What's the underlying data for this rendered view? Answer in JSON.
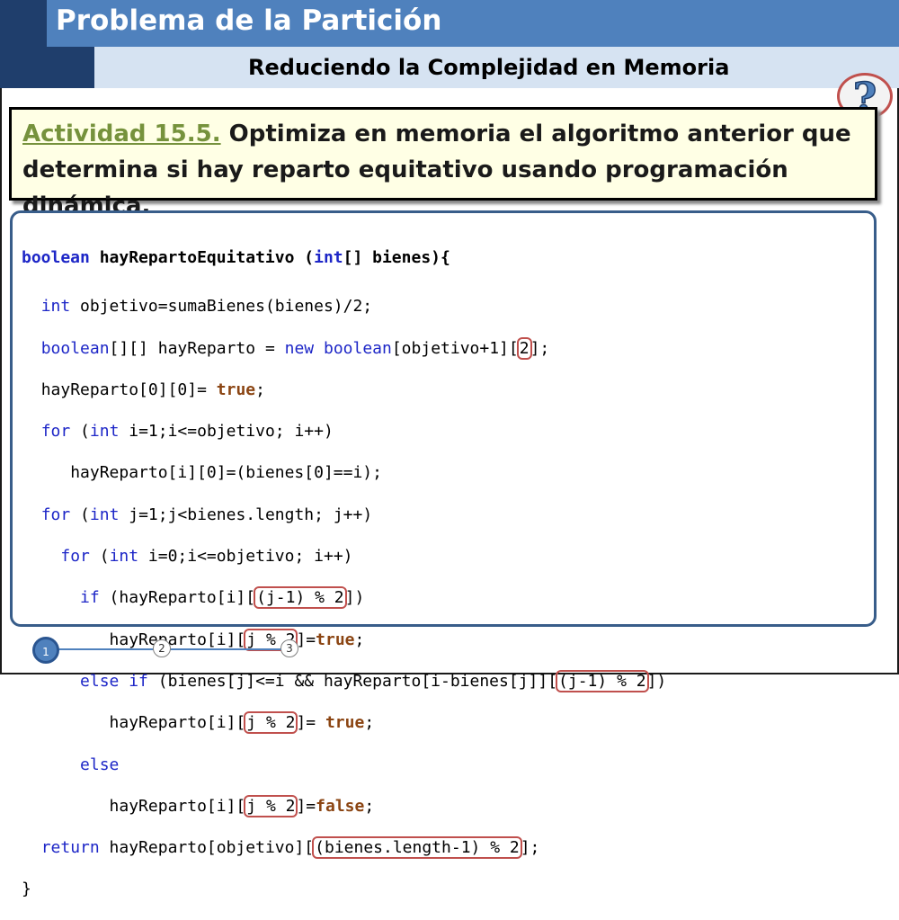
{
  "header": {
    "title": "Problema de la Partición",
    "subtitle": "Reduciendo la Complejidad en Memoria",
    "help_icon_text": "?"
  },
  "activity": {
    "label": "Actividad 15.5.",
    "text": " Optimiza en memoria el algoritmo anterior que determina si hay reparto equitativo usando programación dinámica."
  },
  "code": {
    "l1": {
      "kw": "boolean",
      "name": " hayRepartoEquitativo (",
      "kw2": "int",
      "rest": "[] bienes){"
    },
    "l2": {
      "kw": "int",
      "rest": " objetivo=sumaBienes(bienes)/2;"
    },
    "l3": {
      "kw": "boolean",
      "a": "[][] hayReparto = ",
      "kw2": "new",
      "kw3": " boolean",
      "b": "[objetivo+1][",
      "hl": "2",
      "c": "];"
    },
    "l4": {
      "a": "hayReparto[0][0]= ",
      "lit": "true",
      "b": ";"
    },
    "l5": {
      "kw": "for",
      "a": " (",
      "kw2": "int",
      "b": " i=1;i<=objetivo; i++)"
    },
    "l6": {
      "a": "hayReparto[i][0]=(bienes[0]==i);"
    },
    "l7": {
      "kw": "for",
      "a": " (",
      "kw2": "int",
      "b": " j=1;j<bienes.length; j++)"
    },
    "l8": {
      "kw": "for",
      "a": " (",
      "kw2": "int",
      "b": " i=0;i<=objetivo; i++)"
    },
    "l9": {
      "kw": "if",
      "a": " (hayReparto[i][",
      "hl": "(j-1) % 2",
      "b": "])"
    },
    "l10": {
      "a": "hayReparto[i][",
      "hl": "j % 2",
      "b": "]=",
      "lit": "true",
      "c": ";"
    },
    "l11": {
      "kw": "else if",
      "a": " (bienes[j]<=i && hayReparto[i-bienes[j]][",
      "hl": "(j-1) % 2",
      "b": "])"
    },
    "l12": {
      "a": "hayReparto[i][",
      "hl": "j % 2",
      "b": "]= ",
      "lit": "true",
      "c": ";"
    },
    "l13": {
      "kw": "else"
    },
    "l14": {
      "a": "hayReparto[i][",
      "hl": "j % 2",
      "b": "]=",
      "lit": "false",
      "c": ";"
    },
    "l15": {
      "kw": "return",
      "a": " hayReparto[objetivo][",
      "hl": "(bienes.length-1) % 2",
      "b": "];"
    },
    "l16": {
      "a": "}"
    }
  },
  "pagination": {
    "pages": [
      "1",
      "2",
      "3"
    ],
    "current": "1"
  },
  "colors": {
    "title_bar": "#4f81bd",
    "dark_accent": "#1f3e6c",
    "subtitle_bar": "#d6e3f2",
    "activity_label": "#76923c",
    "highlight_box": "#c0504d",
    "keyword": "#1d26c7",
    "literal": "#8b4513"
  }
}
